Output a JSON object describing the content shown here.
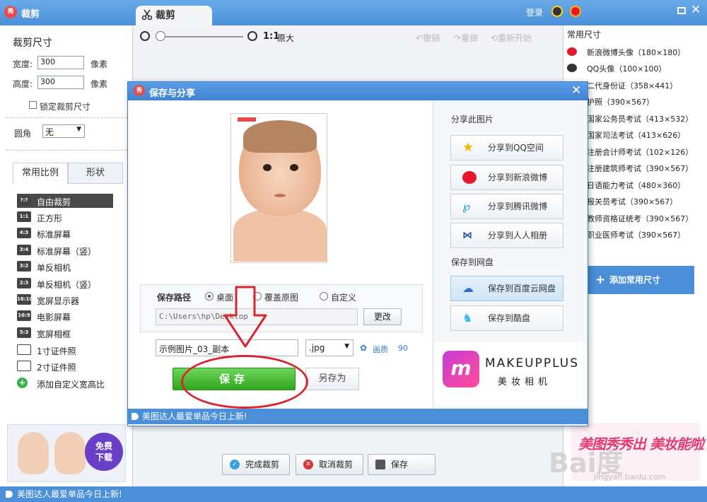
{
  "app": {
    "title": "裁剪",
    "tab_label": "裁剪",
    "login": "登录"
  },
  "crop_size": {
    "title": "裁剪尺寸",
    "width_label": "宽度:",
    "width_value": "300",
    "width_unit": "像素",
    "height_label": "高度:",
    "height_value": "300",
    "height_unit": "像素",
    "lock_label": "锁定裁剪尺寸",
    "corner_label": "圆角",
    "corner_value": "无"
  },
  "tabs": [
    {
      "label": "常用比例"
    },
    {
      "label": "形状"
    }
  ],
  "ratios": [
    {
      "icon": "?:?",
      "label": "自由裁剪"
    },
    {
      "icon": "1:1",
      "label": "正方形"
    },
    {
      "icon": "4:3",
      "label": "标准屏幕"
    },
    {
      "icon": "3:4",
      "label": "标准屏幕（竖）"
    },
    {
      "icon": "3:2",
      "label": "单反相机"
    },
    {
      "icon": "2:3",
      "label": "单反相机（竖）"
    },
    {
      "icon": "16:10",
      "label": "宽屏显示器"
    },
    {
      "icon": "16:9",
      "label": "电影屏幕"
    },
    {
      "icon": "5:3",
      "label": "宽屏相框"
    },
    {
      "icon": "",
      "label": "1寸证件照"
    },
    {
      "icon": "",
      "label": "2寸证件照"
    },
    {
      "icon": "+",
      "label": "添加自定义宽高比"
    }
  ],
  "toolbar": {
    "ratio": "1:1",
    "original": "原大",
    "undo": "撤销",
    "redo": "重做",
    "restart": "重新开始"
  },
  "common_sizes": {
    "title": "常用尺寸",
    "items": [
      "新浪微博头像（180×180）",
      "QQ头像（100×100）",
      "二代身份证（358×441）",
      "护照（390×567）",
      "国家公务员考试（413×532）",
      "国家司法考试（413×626）",
      "注册会计师考试（102×126）",
      "注册建筑师考试（390×567）",
      "日语能力考试（480×360）",
      "报关员考试（390×567）",
      "教师资格证统考（390×567）",
      "职业医师考试（390×567）"
    ],
    "add_button": "添加常用尺寸"
  },
  "bottom_buttons": {
    "finish": "完成裁剪",
    "cancel": "取消裁剪",
    "save": "保存"
  },
  "status_text": "美图达人最爱单品今日上新!",
  "promo_left": {
    "badge_line1": "免费",
    "badge_line2": "下载"
  },
  "promo_right": {
    "text": "美图秀秀出 美妆能啦了!"
  },
  "watermark": {
    "text": "Bai度",
    "url": "jingyan.baidu.com"
  },
  "dialog": {
    "title": "保存与分享",
    "save_path_label": "保存路径",
    "radio_desktop": "桌面",
    "radio_overwrite": "覆盖原图",
    "radio_custom": "自定义",
    "path_value": "C:\\Users\\hp\\Desktop",
    "change_button": "更改",
    "filename_value": "示例图片_03_副本",
    "extension": ".jpg",
    "quality_label": "画质",
    "quality_value": "90",
    "save_button": "保存",
    "saveas_button": "另存为",
    "share_title": "分享此图片",
    "share": [
      "分享到QQ空间",
      "分享到新浪微博",
      "分享到腾讯微博",
      "分享到人人相册"
    ],
    "cloud_title": "保存到网盘",
    "cloud": [
      "保存到百度云网盘",
      "保存到酷盘"
    ],
    "banner_name": "MAKEUPPLUS",
    "banner_sub": "美妆相机",
    "status_text": "美图达人最爱单品今日上新!"
  },
  "colors": {
    "accent": "#4a8fd8",
    "save_green": "#2fa51d",
    "annotation_red": "#d9262e"
  }
}
